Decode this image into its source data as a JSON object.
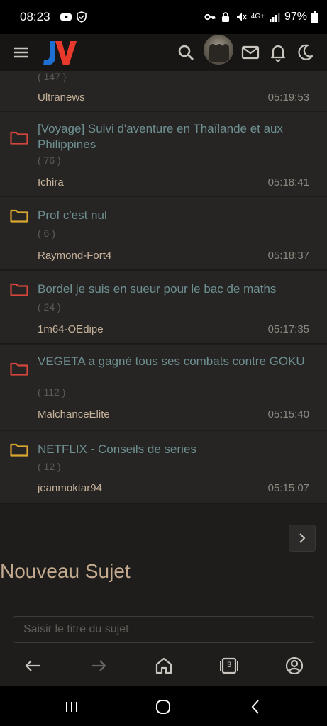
{
  "status_bar": {
    "time": "08:23",
    "battery": "97%",
    "network": "4G+"
  },
  "app": {
    "logo_text": "JV"
  },
  "topics_partial": {
    "count": "( 147 )",
    "author": "Ultranews",
    "time": "05:19:53"
  },
  "topics": [
    {
      "title": "[Voyage] Suivi d'aventure en Thaïlande et aux Philippines",
      "count": "( 76 )",
      "author": "Ichira",
      "time": "05:18:41",
      "folder": "red"
    },
    {
      "title": "Prof c'est nul",
      "count": "( 6 )",
      "author": "Raymond-Fort4",
      "time": "05:18:37",
      "folder": "yellow"
    },
    {
      "title": "Bordel je suis en sueur pour le bac de maths",
      "count": "( 24 )",
      "author": "1m64-OEdipe",
      "time": "05:17:35",
      "folder": "red"
    },
    {
      "title": "VEGETA a gagné tous ses combats contre GOKU",
      "count": "( 112 )",
      "author": "MalchanceElite",
      "time": "05:15:40",
      "folder": "red"
    },
    {
      "title": "NETFLIX - Conseils de series",
      "count": "( 12 )",
      "author": "jeanmoktar94",
      "time": "05:15:07",
      "folder": "yellow"
    }
  ],
  "new_topic": {
    "heading": "Nouveau Sujet",
    "placeholder": "Saisir le titre du sujet",
    "value": ""
  },
  "browser": {
    "tab_count": "3"
  },
  "colors": {
    "folder_red": "#d2463b",
    "folder_yellow": "#d9a630",
    "title": "#6f9091",
    "author": "#c6b29b"
  }
}
